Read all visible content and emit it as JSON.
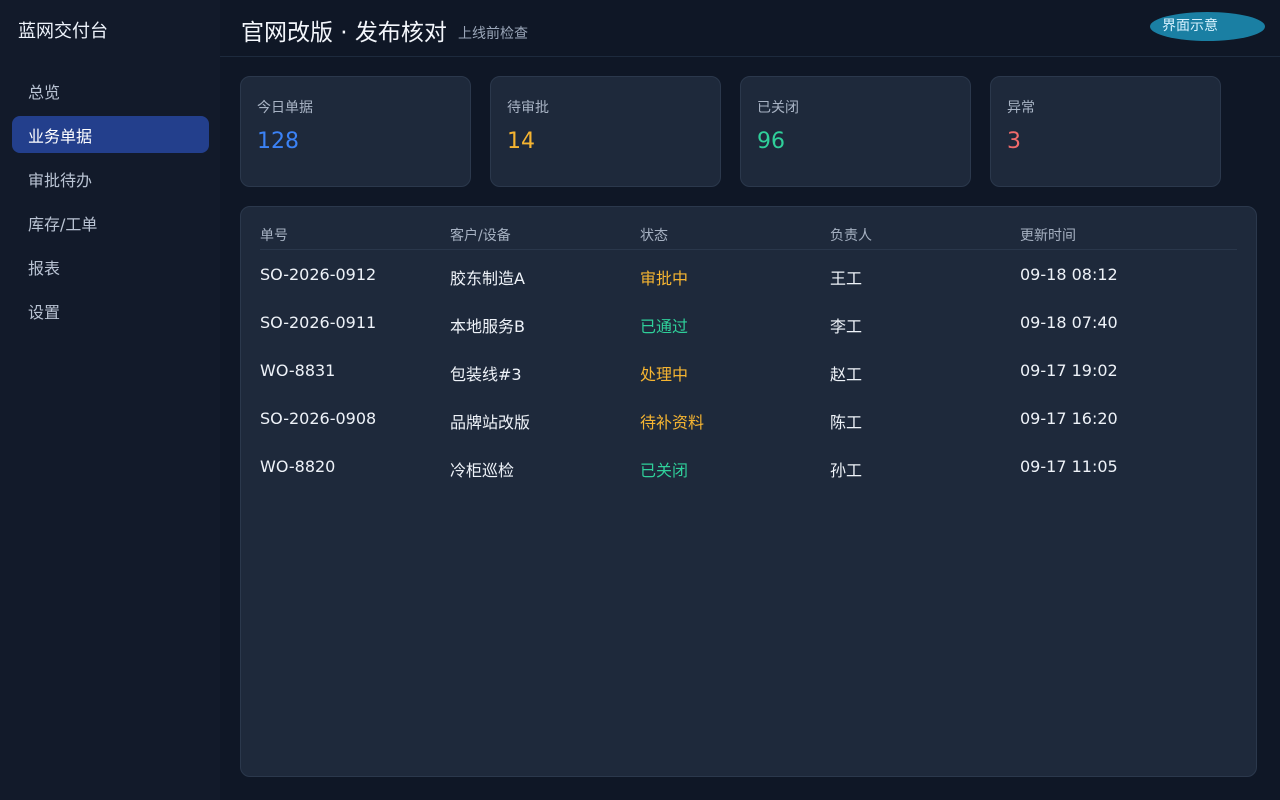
{
  "sidebar": {
    "brand": "蓝网交付台",
    "items": [
      {
        "label": "总览",
        "active": false
      },
      {
        "label": "业务单据",
        "active": true
      },
      {
        "label": "审批待办",
        "active": false
      },
      {
        "label": "库存/工单",
        "active": false
      },
      {
        "label": "报表",
        "active": false
      },
      {
        "label": "设置",
        "active": false
      }
    ]
  },
  "header": {
    "title": "官网改版 · 发布核对",
    "subtitle": "上线前检查",
    "badge": "界面示意"
  },
  "stats": [
    {
      "label": "今日单据",
      "value": "128",
      "color": "#3b82f6"
    },
    {
      "label": "待审批",
      "value": "14",
      "color": "#f5b431"
    },
    {
      "label": "已关闭",
      "value": "96",
      "color": "#2fcf9a"
    },
    {
      "label": "异常",
      "value": "3",
      "color": "#f26b6b"
    }
  ],
  "table": {
    "columns": [
      "单号",
      "客户/设备",
      "状态",
      "负责人",
      "更新时间"
    ],
    "rows": [
      {
        "id": "SO-2026-0912",
        "client": "胶东制造A",
        "status": "审批中",
        "status_color": "#f5b431",
        "owner": "王工",
        "updated": "09-18 08:12"
      },
      {
        "id": "SO-2026-0911",
        "client": "本地服务B",
        "status": "已通过",
        "status_color": "#2fcf9a",
        "owner": "李工",
        "updated": "09-18 07:40"
      },
      {
        "id": "WO-8831",
        "client": "包装线#3",
        "status": "处理中",
        "status_color": "#f5b431",
        "owner": "赵工",
        "updated": "09-17 19:02"
      },
      {
        "id": "SO-2026-0908",
        "client": "品牌站改版",
        "status": "待补资料",
        "status_color": "#f5b431",
        "owner": "陈工",
        "updated": "09-17 16:20"
      },
      {
        "id": "WO-8820",
        "client": "冷柜巡检",
        "status": "已关闭",
        "status_color": "#2fcf9a",
        "owner": "孙工",
        "updated": "09-17 11:05"
      }
    ]
  }
}
